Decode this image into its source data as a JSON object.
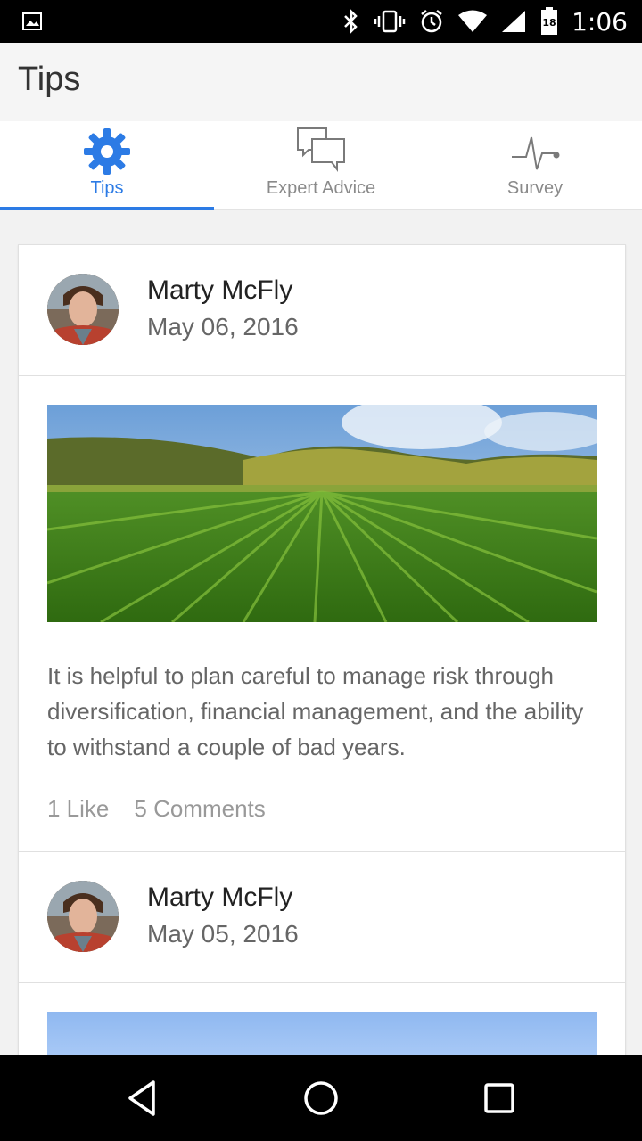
{
  "status_bar": {
    "time": "1:06",
    "battery_level": "18",
    "icons": [
      "image-icon",
      "bluetooth-icon",
      "vibrate-icon",
      "alarm-icon",
      "wifi-icon",
      "signal-icon",
      "battery-icon"
    ]
  },
  "app_bar": {
    "title": "Tips"
  },
  "tabs": [
    {
      "label": "Tips",
      "icon": "gear-icon",
      "active": true
    },
    {
      "label": "Expert Advice",
      "icon": "chat-bubbles-icon",
      "active": false
    },
    {
      "label": "Survey",
      "icon": "pulse-icon",
      "active": false
    }
  ],
  "colors": {
    "accent": "#2c7be5",
    "tab_inactive": "#8a8a8a"
  },
  "posts": [
    {
      "author": "Marty McFly",
      "date": "May 06, 2016",
      "text": "It is helpful to plan careful to manage risk through diversification, financial management, and the ability to withstand a couple of bad years.",
      "likes": "1 Like",
      "comments": "5 Comments"
    },
    {
      "author": "Marty McFly",
      "date": "May 05, 2016"
    }
  ],
  "nav_bar": {
    "buttons": [
      "back-icon",
      "home-icon",
      "recents-icon"
    ]
  }
}
